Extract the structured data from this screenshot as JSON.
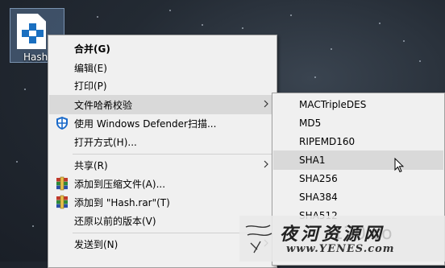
{
  "desktop": {
    "file_label": "Hash"
  },
  "context_menu": {
    "items": [
      {
        "label": "合并(G)",
        "bold": true
      },
      {
        "label": "编辑(E)"
      },
      {
        "label": "打印(P)"
      },
      {
        "label": "文件哈希校验",
        "has_submenu": true,
        "highlighted": true
      },
      {
        "label": "使用 Windows Defender扫描...",
        "icon": "windows-defender-shield-icon"
      },
      {
        "label": "打开方式(H)..."
      },
      {
        "label": "共享(R)",
        "has_submenu": true
      },
      {
        "label": "添加到压缩文件(A)...",
        "icon": "winrar-icon"
      },
      {
        "label": "添加到 \"Hash.rar\"(T)",
        "icon": "winrar-icon"
      },
      {
        "label": "还原以前的版本(V)"
      },
      {
        "label": "发送到(N)",
        "has_submenu": true
      }
    ]
  },
  "hash_submenu": {
    "items": [
      {
        "label": "MACTripleDES"
      },
      {
        "label": "MD5"
      },
      {
        "label": "RIPEMD160"
      },
      {
        "label": "SHA1",
        "highlighted": true
      },
      {
        "label": "SHA256"
      },
      {
        "label": "SHA384"
      },
      {
        "label": "SHA512"
      }
    ]
  },
  "watermark": {
    "title": "夜河资源网",
    "url": "www.YENES.com",
    "ghost_text": "120.co"
  },
  "colors": {
    "menu_bg": "#f0f0f0",
    "highlight": "#d9d9d9",
    "defender_blue": "#1b6ac9"
  }
}
